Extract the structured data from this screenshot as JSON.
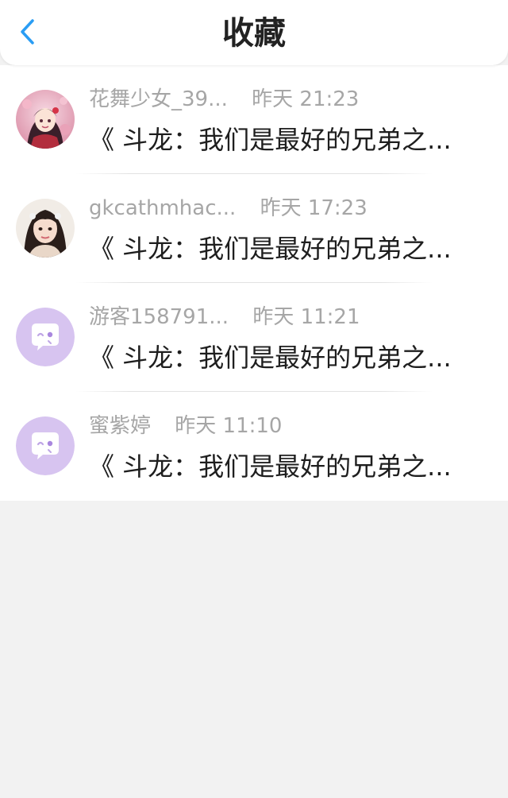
{
  "header": {
    "title": "收藏",
    "back_icon": "chevron-left-icon",
    "accent_color": "#2a9df4"
  },
  "items": [
    {
      "name": "花舞少女_39...",
      "time": "昨天 21:23",
      "message": "《 斗龙：我们是最好的兄弟之...",
      "avatar": "anime-girl-avatar"
    },
    {
      "name": "gkcathmhac...",
      "time": "昨天 17:23",
      "message": "《 斗龙：我们是最好的兄弟之...",
      "avatar": "photo-girl-avatar"
    },
    {
      "name": "游客158791...",
      "time": "昨天 11:21",
      "message": "《 斗龙：我们是最好的兄弟之...",
      "avatar": "chat-bubble-avatar"
    },
    {
      "name": "蜜紫婷",
      "time": "昨天 11:10",
      "message": "《 斗龙：我们是最好的兄弟之...",
      "avatar": "chat-bubble-avatar"
    }
  ]
}
